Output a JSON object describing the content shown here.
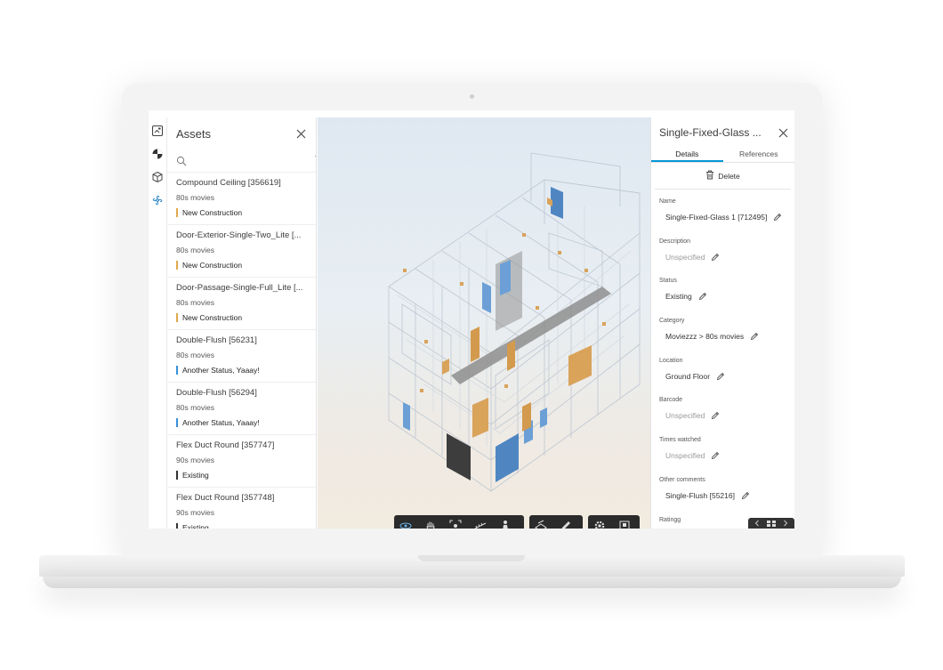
{
  "assets": {
    "title": "Assets",
    "search_placeholder": "",
    "items": [
      {
        "name": "Compound Ceiling [356619]",
        "sub": "80s movies",
        "status": "New Construction",
        "status_color": "#e0a84c"
      },
      {
        "name": "Door-Exterior-Single-Two_Lite [...",
        "sub": "80s movies",
        "status": "New Construction",
        "status_color": "#e0a84c"
      },
      {
        "name": "Door-Passage-Single-Full_Lite [...",
        "sub": "80s movies",
        "status": "New Construction",
        "status_color": "#e0a84c"
      },
      {
        "name": "Double-Flush [56231]",
        "sub": "80s movies",
        "status": "Another Status, Yaaay!",
        "status_color": "#3a8fd8"
      },
      {
        "name": "Double-Flush [56294]",
        "sub": "80s movies",
        "status": "Another Status, Yaaay!",
        "status_color": "#3a8fd8"
      },
      {
        "name": "Flex Duct Round [357747]",
        "sub": "90s movies",
        "status": "Existing",
        "status_color": "#333333"
      },
      {
        "name": "Flex Duct Round [357748]",
        "sub": "90s movies",
        "status": "Existing",
        "status_color": "#333333"
      }
    ]
  },
  "details": {
    "title": "Single-Fixed-Glass ...",
    "tabs": [
      {
        "label": "Details",
        "active": true
      },
      {
        "label": "References",
        "active": false
      }
    ],
    "delete_label": "Delete",
    "fields": [
      {
        "label": "Name",
        "value": "Single-Fixed-Glass 1 [712495]",
        "muted": false
      },
      {
        "label": "Description",
        "value": "Unspecified",
        "muted": true
      },
      {
        "label": "Status",
        "value": "Existing",
        "muted": false
      },
      {
        "label": "Category",
        "value": "Moviezzz > 80s movies",
        "muted": false
      },
      {
        "label": "Location",
        "value": "Ground Floor",
        "muted": false
      },
      {
        "label": "Barcode",
        "value": "Unspecified",
        "muted": true
      },
      {
        "label": "Times watched",
        "value": "Unspecified",
        "muted": true
      },
      {
        "label": "Other comments",
        "value": "Single-Flush [55216]",
        "muted": false
      },
      {
        "label": "Ratingg",
        "value": "",
        "muted": false
      }
    ]
  },
  "colors": {
    "accent": "#0696d7",
    "door_orange": "#d9a35a",
    "door_blue": "#5b93cf",
    "toolbar": "#2b2b2b"
  },
  "icons": {
    "rail": [
      "image-icon",
      "globe-icon",
      "box-icon",
      "fan-icon"
    ],
    "toolbar": [
      "orbit-icon",
      "pan-icon",
      "fit-icon",
      "measure-icon",
      "person-icon",
      "section-icon",
      "markup-icon",
      "settings-icon",
      "fullscreen-icon"
    ]
  }
}
